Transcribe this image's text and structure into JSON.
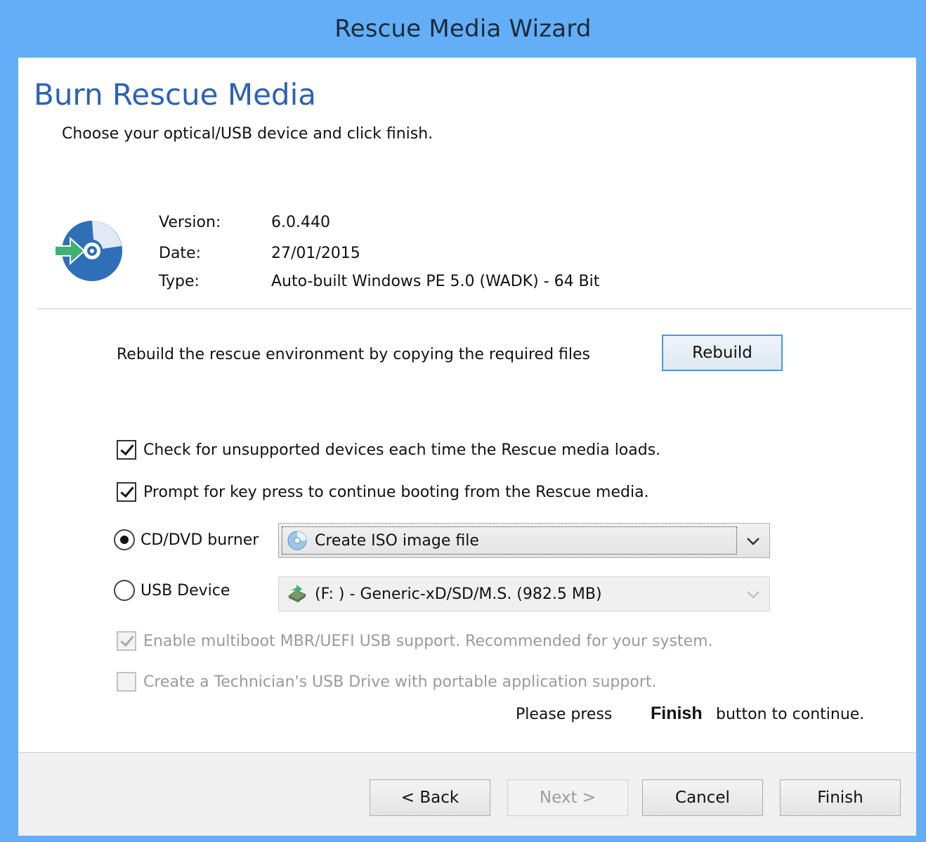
{
  "window": {
    "title": "Rescue Media Wizard"
  },
  "page": {
    "heading": "Burn Rescue Media",
    "subheading": "Choose your optical/USB device and click finish."
  },
  "info": {
    "version_label": "Version:",
    "version_value": "6.0.440",
    "date_label": "Date:",
    "date_value": "27/01/2015",
    "type_label": "Type:",
    "type_value": "Auto-built Windows PE 5.0 (WADK) - 64 Bit"
  },
  "rebuild": {
    "text": "Rebuild the rescue environment by copying the required files",
    "button": "Rebuild"
  },
  "options": {
    "check_unsupported": {
      "label": "Check for unsupported devices each time the Rescue media loads.",
      "checked": true
    },
    "prompt_keypress": {
      "label": "Prompt for key press to continue booting from the Rescue media.",
      "checked": true
    },
    "multiboot": {
      "label": "Enable multiboot MBR/UEFI USB support. Recommended for your system.",
      "checked": true,
      "enabled": false
    },
    "technician_usb": {
      "label": "Create a Technician's USB Drive with portable application support.",
      "checked": false,
      "enabled": false
    }
  },
  "devices": {
    "cd_label": "CD/DVD burner",
    "cd_selected": true,
    "cd_value": "Create ISO image file",
    "usb_label": "USB Device",
    "usb_selected": false,
    "usb_value": "(F: ) - Generic-xD/SD/M.S. (982.5 MB)"
  },
  "instruction": {
    "prefix": "Please press",
    "bold": "Finish",
    "suffix": "button to continue."
  },
  "footer": {
    "back": "< Back",
    "next": "Next >",
    "cancel": "Cancel",
    "finish": "Finish"
  },
  "icons": {
    "disc": "disc-arrow-icon",
    "iso": "disc-small-icon",
    "usb": "usb-drive-icon",
    "chevron": "chevron-down-icon"
  },
  "colors": {
    "frame": "#63aef7",
    "heading": "#2c61b6",
    "disc": "#2f6fb7",
    "arrow": "#3cb371"
  }
}
